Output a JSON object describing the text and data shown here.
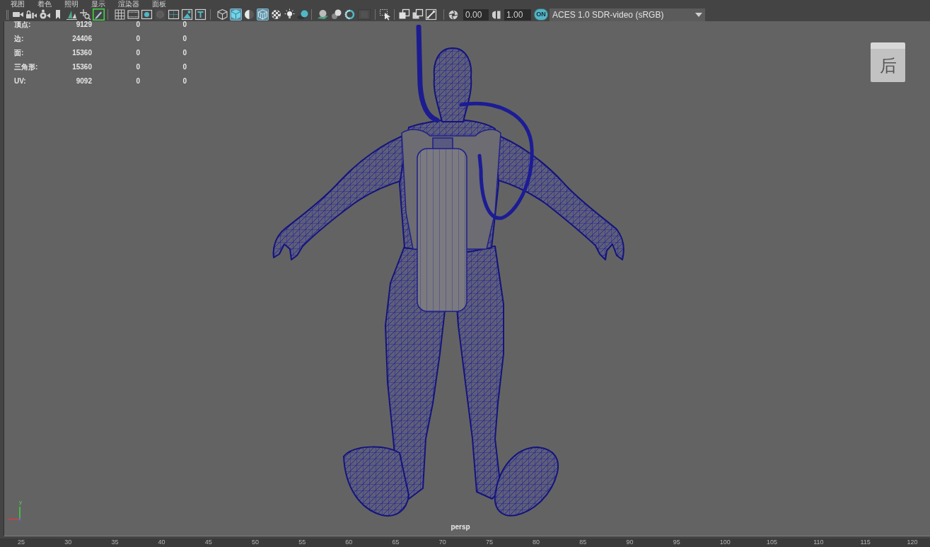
{
  "menu_bar": [
    {
      "label": "视图"
    },
    {
      "label": "着色"
    },
    {
      "label": "照明"
    },
    {
      "label": "显示"
    },
    {
      "label": "渲染器"
    },
    {
      "label": "面板"
    }
  ],
  "toolbar": {
    "groups": [
      [
        {
          "kind": "camera",
          "selected": false
        },
        {
          "kind": "camlock",
          "selected": false
        },
        {
          "kind": "camattr",
          "selected": false
        },
        {
          "kind": "bookmark",
          "selected": false
        },
        {
          "kind": "imageplane",
          "selected": false
        },
        {
          "kind": "panzoom",
          "selected": false
        },
        {
          "kind": "pencil",
          "selected": true
        }
      ],
      [
        {
          "kind": "grid",
          "selected": false
        },
        {
          "kind": "filmgate",
          "selected": false
        },
        {
          "kind": "resgate",
          "selected": false
        },
        {
          "kind": "gatemask",
          "selected": false
        },
        {
          "kind": "fieldchart",
          "selected": false
        },
        {
          "kind": "safeaction",
          "selected": false
        },
        {
          "kind": "safetitle",
          "selected": false
        }
      ],
      [
        {
          "kind": "wireframe",
          "selected": false
        },
        {
          "kind": "shaded",
          "selected": true
        },
        {
          "kind": "lighting",
          "selected": false
        },
        {
          "kind": "wireshaded",
          "selected": true
        },
        {
          "kind": "textured",
          "selected": false
        },
        {
          "kind": "lights",
          "selected": false
        },
        {
          "kind": "shadows",
          "selected": false
        }
      ],
      [
        {
          "kind": "occlusion",
          "selected": false
        },
        {
          "kind": "motionblur",
          "selected": false
        },
        {
          "kind": "antialias",
          "selected": false
        },
        {
          "kind": "dof",
          "selected": false
        }
      ],
      [
        {
          "kind": "marquee",
          "selected": false
        }
      ],
      [
        {
          "kind": "isolate",
          "selected": false
        },
        {
          "kind": "xray",
          "selected": false
        },
        {
          "kind": "xrayjoints",
          "selected": false
        }
      ]
    ],
    "exposure": "0.00",
    "gamma": "1.00",
    "color_management": {
      "label": "ON",
      "on": true
    },
    "view_transform": "ACES 1.0 SDR-video (sRGB)"
  },
  "hud_stats": [
    {
      "label": "顶点:",
      "values": [
        "9129",
        "0",
        "0"
      ]
    },
    {
      "label": "边:",
      "values": [
        "24406",
        "0",
        "0"
      ]
    },
    {
      "label": "面:",
      "values": [
        "15360",
        "0",
        "0"
      ]
    },
    {
      "label": "三角形:",
      "values": [
        "15360",
        "0",
        "0"
      ]
    },
    {
      "label": "UV:",
      "values": [
        "9092",
        "0",
        "0"
      ]
    }
  ],
  "view_cube": {
    "label": "后"
  },
  "axis_indicator": {
    "label": "y"
  },
  "camera_label": "persp",
  "time_ruler": {
    "ticks": [
      "25",
      "30",
      "35",
      "40",
      "45",
      "50",
      "55",
      "60",
      "65",
      "70",
      "75",
      "80",
      "85",
      "90",
      "95",
      "100",
      "105",
      "110",
      "115",
      "120"
    ]
  }
}
